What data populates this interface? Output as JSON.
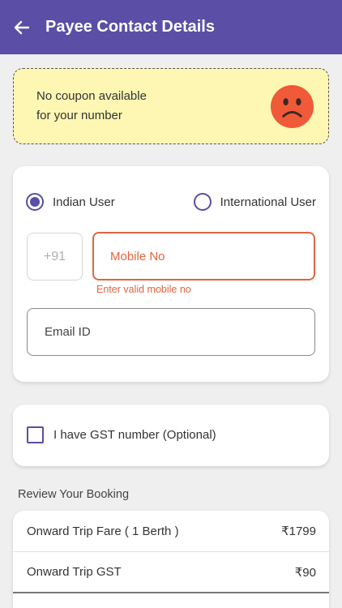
{
  "appbar": {
    "title": "Payee Contact Details",
    "back_icon": "arrow-left-icon",
    "color": "#5a4ea6"
  },
  "coupon": {
    "line1": "No coupon available",
    "line2": "for your number",
    "icon": "sad-face-icon",
    "background": "#fdf7b3"
  },
  "contact": {
    "user_type_options": [
      {
        "label": "Indian User",
        "selected": true
      },
      {
        "label": "International User",
        "selected": false
      }
    ],
    "country_code": "+91",
    "mobile": {
      "value": "",
      "placeholder": "Mobile No"
    },
    "mobile_error": "Enter valid mobile no",
    "email": {
      "value": "",
      "placeholder": "Email ID"
    },
    "error_color": "#e2643f"
  },
  "gst": {
    "label": "I have GST number (Optional)",
    "checked": false
  },
  "review": {
    "title": "Review Your Booking",
    "rows": [
      {
        "label": "Onward Trip Fare ( 1 Berth )",
        "amount": "₹1799"
      },
      {
        "label": "Onward Trip GST",
        "amount": "₹90"
      }
    ]
  }
}
